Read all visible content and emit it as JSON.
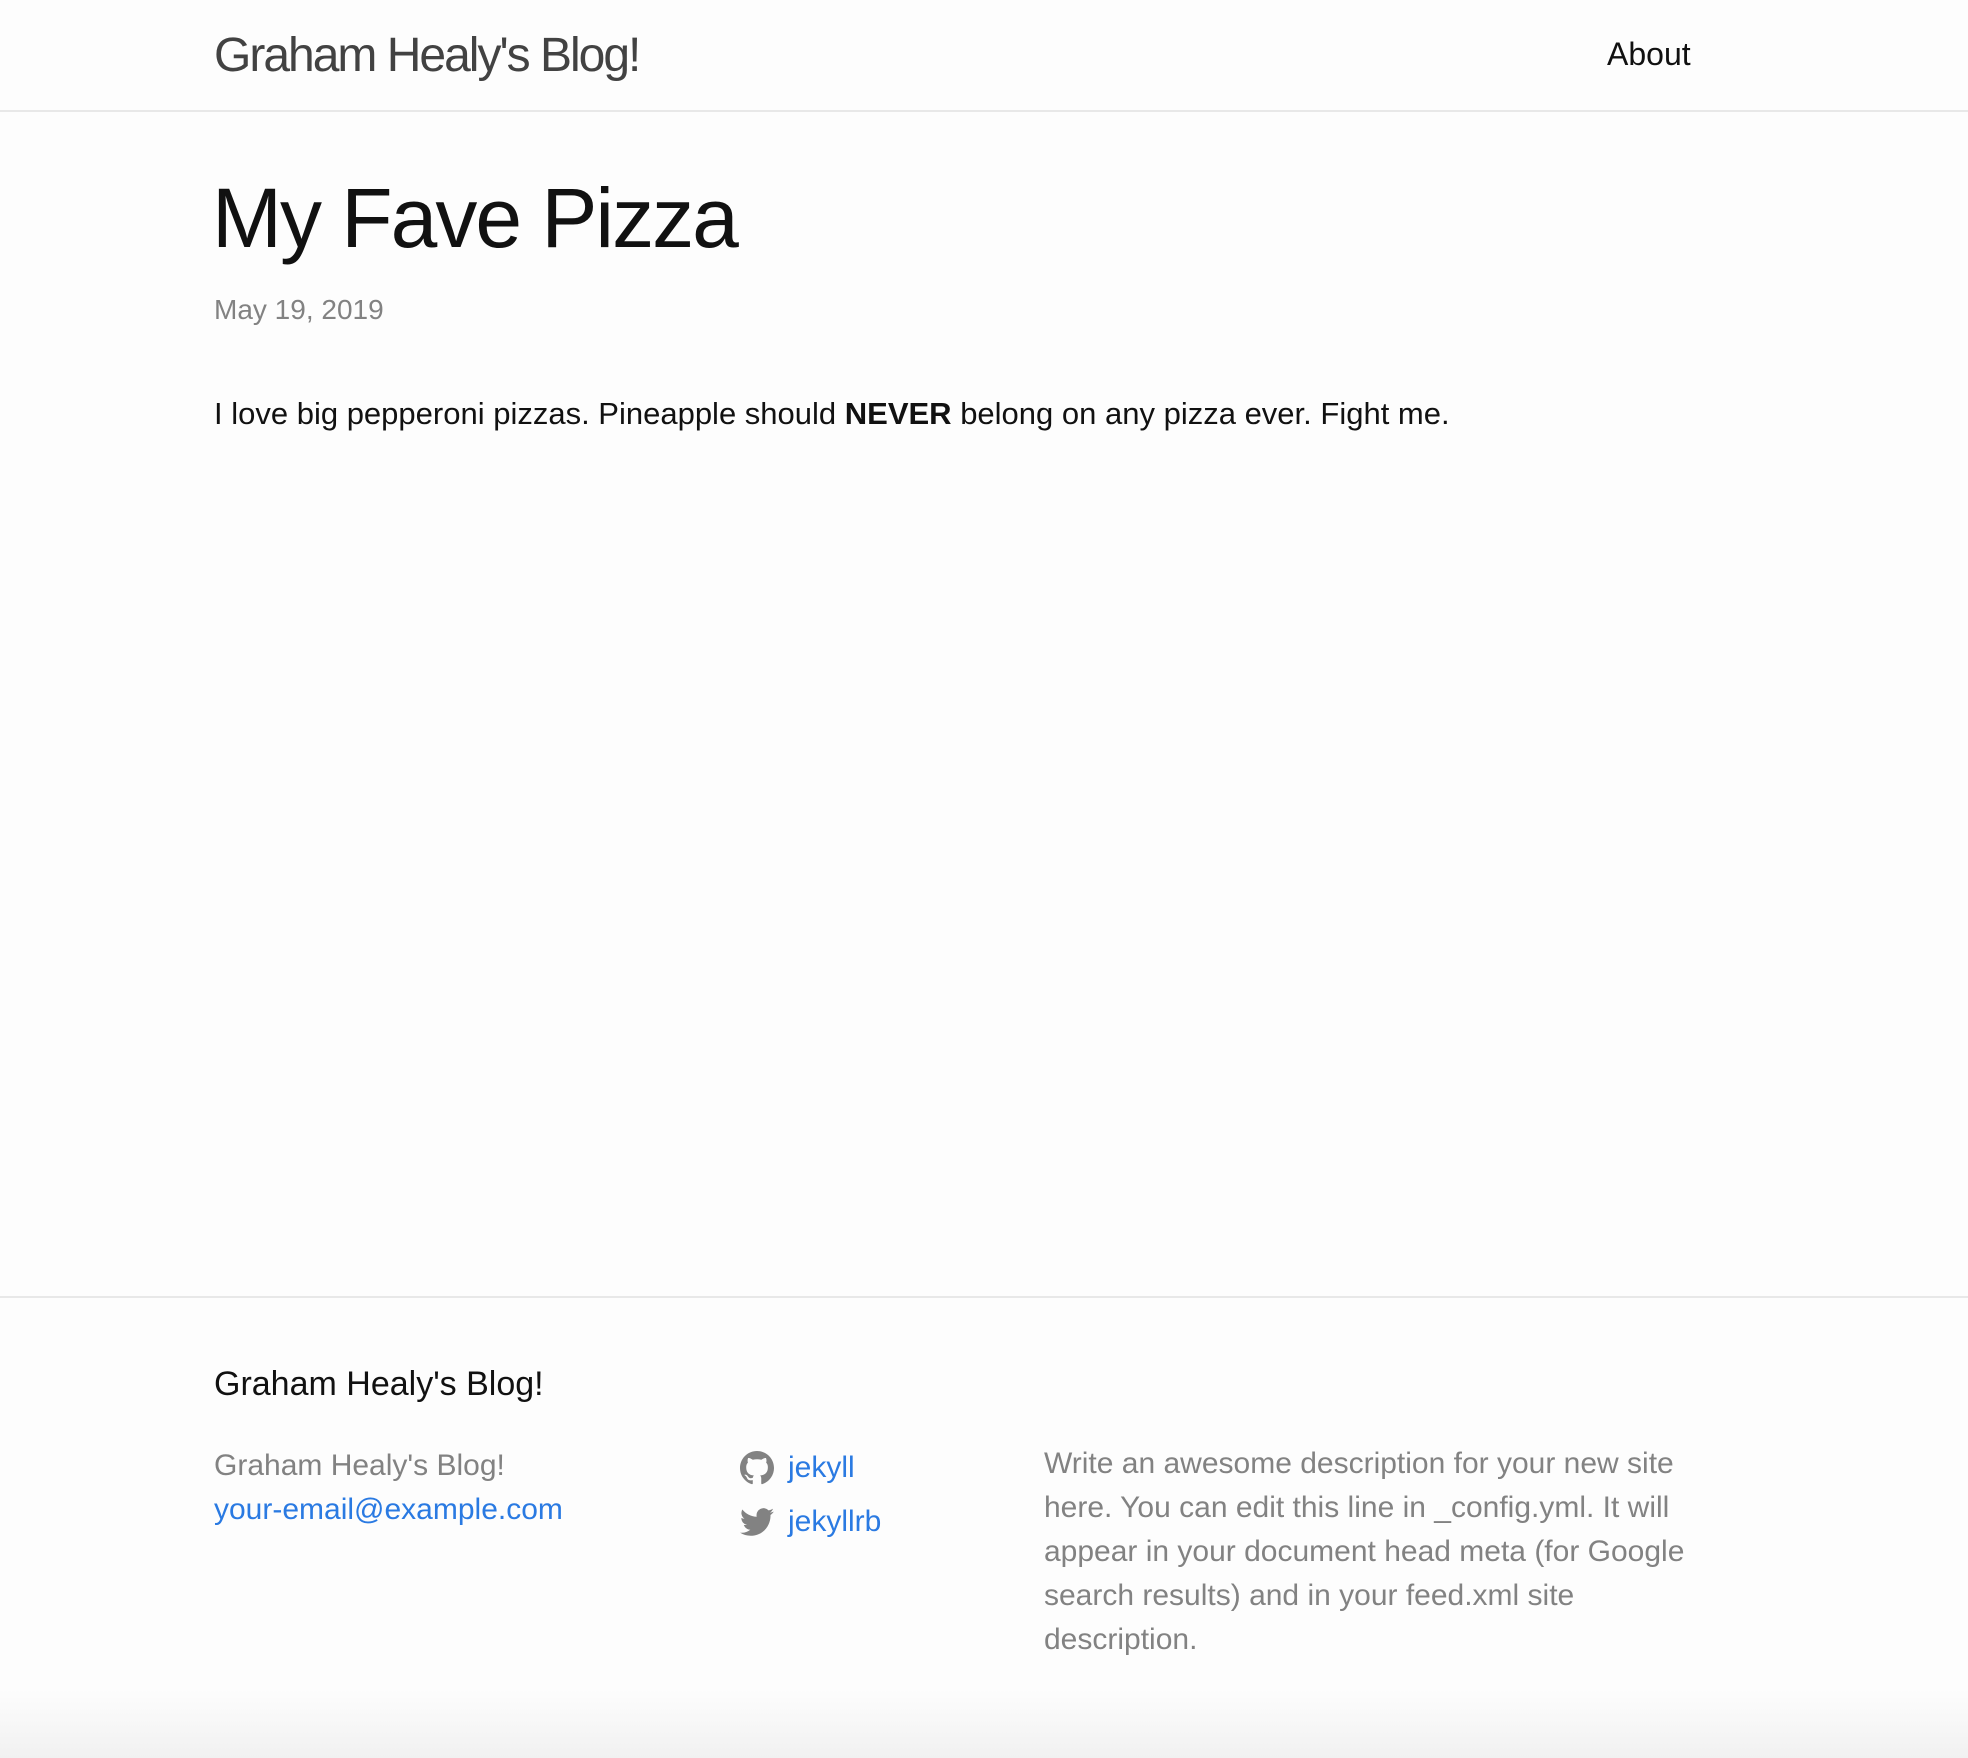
{
  "header": {
    "site_title": "Graham Healy's Blog!",
    "nav": [
      {
        "label": "About"
      }
    ]
  },
  "post": {
    "title": "My Fave Pizza",
    "date": "May 19, 2019",
    "body": {
      "before": "I love big pepperoni pizzas. Pineapple should ",
      "strong": "NEVER",
      "after": " belong on any pizza ever. Fight me."
    }
  },
  "footer": {
    "heading": "Graham Healy's Blog!",
    "contact": {
      "name": "Graham Healy's Blog!",
      "email": "your-email@example.com"
    },
    "social": [
      {
        "icon": "github-icon",
        "label": "jekyll"
      },
      {
        "icon": "twitter-icon",
        "label": "jekyllrb"
      }
    ],
    "description": "Write an awesome description for your new site here. You can edit this line in _config.yml. It will appear in your document head meta (for Google search results) and in your feed.xml site description."
  },
  "colors": {
    "link": "#2a7ae2",
    "muted": "#828282",
    "title": "#424242",
    "text": "#111111",
    "border": "#e8e8e8",
    "background": "#fdfdfd"
  }
}
